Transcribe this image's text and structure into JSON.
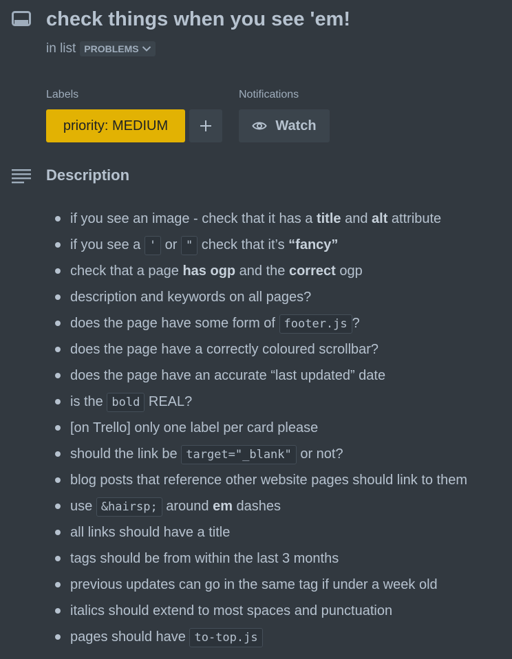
{
  "card": {
    "title": "check things when you see 'em!",
    "in_list_prefix": "in list",
    "list_name": "PROBLEMS"
  },
  "labels_section": {
    "heading": "Labels",
    "label_text": "priority: MEDIUM",
    "label_color": "#e2b203",
    "add_icon": "plus-icon"
  },
  "notifications_section": {
    "heading": "Notifications",
    "watch_label": "Watch",
    "watch_icon": "eye-icon"
  },
  "description": {
    "heading": "Description",
    "items": [
      [
        {
          "t": "if you see an image - check that it has a "
        },
        {
          "b": "title"
        },
        {
          "t": " and "
        },
        {
          "b": "alt"
        },
        {
          "t": " attribute"
        }
      ],
      [
        {
          "t": "if you see a "
        },
        {
          "c": "'"
        },
        {
          "t": " or "
        },
        {
          "c": "\""
        },
        {
          "t": " check that it’s "
        },
        {
          "b": "“fancy”"
        }
      ],
      [
        {
          "t": "check that a page "
        },
        {
          "b": "has ogp"
        },
        {
          "t": " and the "
        },
        {
          "b": "correct"
        },
        {
          "t": " ogp"
        }
      ],
      [
        {
          "t": "description and keywords on all pages?"
        }
      ],
      [
        {
          "t": "does the page have some form of "
        },
        {
          "c": "footer.js"
        },
        {
          "t": "?"
        }
      ],
      [
        {
          "t": "does the page have a correctly coloured scrollbar?"
        }
      ],
      [
        {
          "t": "does the page have an accurate “last updated” date"
        }
      ],
      [
        {
          "t": "is the "
        },
        {
          "c": "bold"
        },
        {
          "t": " REAL?"
        }
      ],
      [
        {
          "t": "[on Trello] only one label per card please"
        }
      ],
      [
        {
          "t": "should the link be "
        },
        {
          "c": "target=\"_blank\""
        },
        {
          "t": " or not?"
        }
      ],
      [
        {
          "t": "blog posts that reference other website pages should link to them"
        }
      ],
      [
        {
          "t": "use "
        },
        {
          "c": "&hairsp;"
        },
        {
          "t": " around "
        },
        {
          "b": "em"
        },
        {
          "t": " dashes"
        }
      ],
      [
        {
          "t": "all links should have a title"
        }
      ],
      [
        {
          "t": "tags should be from within the last 3 months"
        }
      ],
      [
        {
          "t": "previous updates can go in the same tag if under a week old"
        }
      ],
      [
        {
          "t": "italics should extend to most spaces and punctuation"
        }
      ],
      [
        {
          "t": "pages should have "
        },
        {
          "c": "to-top.js"
        }
      ]
    ]
  },
  "colors": {
    "background": "#323940",
    "text": "#b6c2cf",
    "muted_text": "#9fadbc",
    "button_bg": "#3b444c"
  }
}
